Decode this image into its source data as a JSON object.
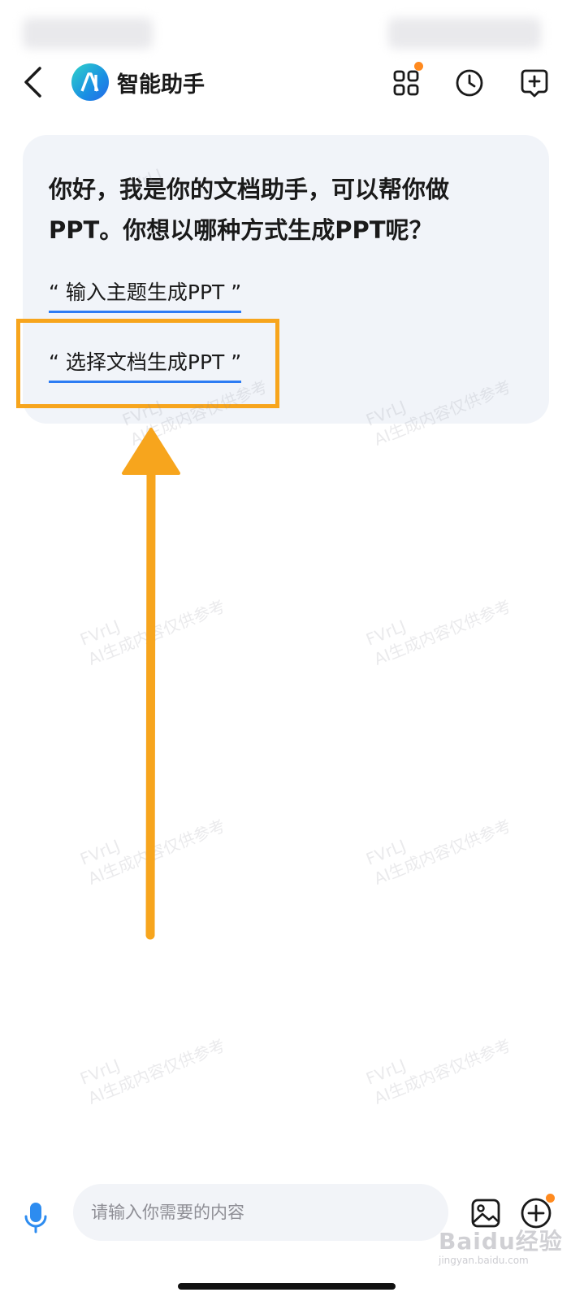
{
  "app": {
    "title": "智能助手",
    "brand_gradient": [
      "#2fd3c9",
      "#1a8fe3",
      "#2468e8"
    ],
    "accent": "#2d7cf3",
    "badge_color": "#ff8a1f"
  },
  "header": {
    "icons": [
      "back-icon",
      "apps-grid-icon",
      "history-clock-icon",
      "new-chat-icon"
    ]
  },
  "message": {
    "greeting": "你好，我是你的文档助手，可以帮你做PPT。你想以哪种方式生成PPT呢？",
    "suggestions": [
      {
        "label": "“ 输入主题生成PPT ”"
      },
      {
        "label": "“ 选择文档生成PPT ”"
      }
    ]
  },
  "annotation": {
    "highlight_color": "#f7a51d",
    "highlighted_suggestion": "“ 选择文档生成PPT ”"
  },
  "watermark": {
    "line1": "FVrLJ",
    "line2": "AI生成内容仅供参考"
  },
  "input": {
    "placeholder": "请输入你需要的内容",
    "value": ""
  },
  "bottom_icons": [
    "microphone-icon",
    "image-upload-icon",
    "plus-icon"
  ],
  "corner_watermark": {
    "text": "Baidu经验",
    "sub": "jingyan.baidu.com"
  }
}
